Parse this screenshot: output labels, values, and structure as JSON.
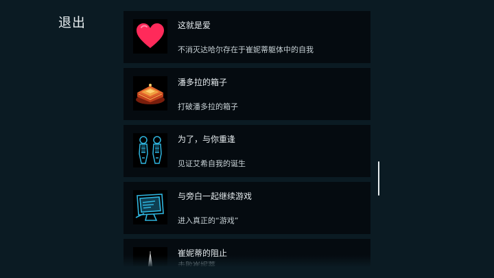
{
  "exit_label": "退出",
  "achievements": [
    {
      "icon": "heart-icon",
      "title": "这就是爱",
      "desc": "不消灭达哈尔存在于崔妮蒂躯体中的自我"
    },
    {
      "icon": "pandora-box-icon",
      "title": "潘多拉的箱子",
      "desc": "打破潘多拉的箱子"
    },
    {
      "icon": "twin-figures-icon",
      "title": "为了，与你重逢",
      "desc": "见证艾希自我的诞生"
    },
    {
      "icon": "computer-monitor-icon",
      "title": "与旁白一起继续游戏",
      "desc": "进入真正的“游戏”"
    },
    {
      "icon": "blade-icon",
      "title": "崔妮蒂的阻止",
      "desc": "击败崔妮蒂"
    }
  ],
  "colors": {
    "background": "#0b1b23",
    "card": "#050b10",
    "heart": "#ff2a5a",
    "box": "#d9502a",
    "holo": "#2fb6e0"
  }
}
